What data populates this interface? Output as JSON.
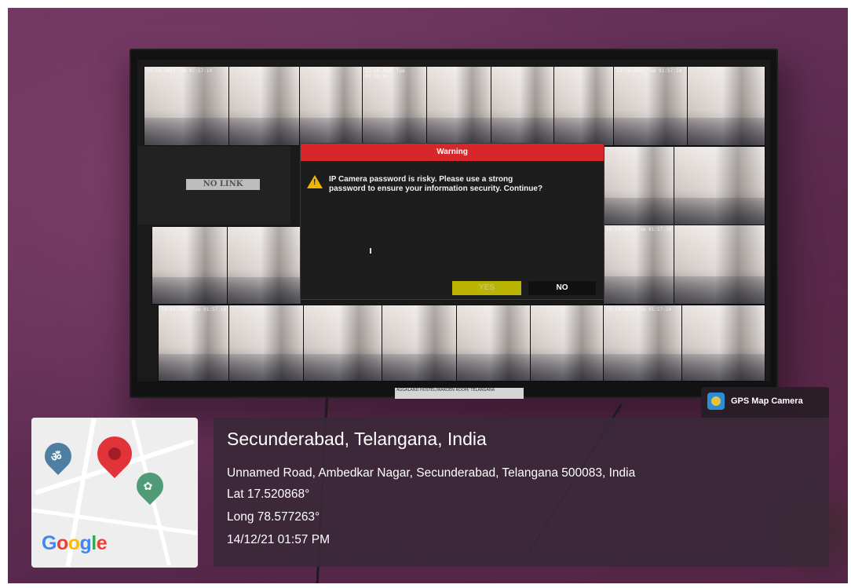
{
  "monitor": {
    "no_link_label": "NO LINK",
    "camera_timestamp": "12-14-2021 Tue 01:57:14",
    "dialog": {
      "title": "Warning",
      "message_line1": "IP Camera password is risky. Please use a strong",
      "message_line2": "password to ensure your information security. Continue?",
      "yes_label": "YES",
      "no_label": "NO",
      "title_color": "#d8272a",
      "yes_color": "#d6d000"
    },
    "tv_label": "AGGALAND HOSTEL/WARDEN ROOM/ TELANGANA"
  },
  "gps_badge": {
    "label": "GPS Map Camera",
    "icon": "camera-icon"
  },
  "map": {
    "logo_text": "Google",
    "pins": [
      "red-location-pin-icon",
      "om-symbol-pin-icon",
      "flower-pin-icon"
    ]
  },
  "location": {
    "city": "Secunderabad, Telangana, India",
    "address": "Unnamed Road, Ambedkar Nagar, Secunderabad, Telangana 500083, India",
    "lat": "Lat 17.520868°",
    "long": "Long 78.577263°",
    "datetime": "14/12/21 01:57 PM"
  }
}
